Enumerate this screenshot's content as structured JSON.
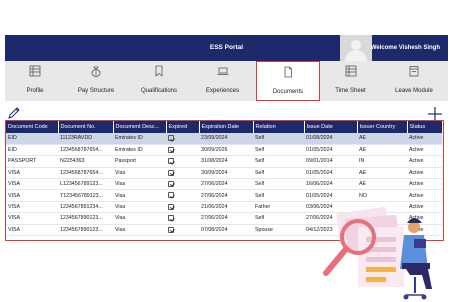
{
  "header": {
    "title": "ESS Portal",
    "welcome": "Welcome Vishesh Singh",
    "accent": "#1c2a6c"
  },
  "nav": {
    "tabs": [
      {
        "label": "Profile",
        "icon": "list-icon"
      },
      {
        "label": "Pay Structure",
        "icon": "money-bag-icon"
      },
      {
        "label": "Qualifications",
        "icon": "bookmark-icon"
      },
      {
        "label": "Experiences",
        "icon": "laptop-icon"
      },
      {
        "label": "Documents",
        "icon": "document-icon",
        "active": true
      },
      {
        "label": "Time Sheet",
        "icon": "list-icon"
      },
      {
        "label": "Leave Module",
        "icon": "calendar-icon"
      }
    ]
  },
  "actions": {
    "edit_icon": "pencil-icon",
    "add_icon": "plus-icon"
  },
  "table": {
    "columns": [
      "Document Code",
      "Document No.",
      "Document Desc...",
      "Expired",
      "Expiration Date",
      "Relation",
      "Issue Date",
      "Issuer Country",
      "Status"
    ],
    "rows": [
      {
        "code": "EID",
        "no": "11123RAVDD",
        "desc": "Emirates ID",
        "expired": true,
        "exp_date": "23/09/2024",
        "relation": "Self",
        "issue_date": "01/08/2024",
        "country": "AE",
        "status": "Active"
      },
      {
        "code": "EID",
        "no": "1234568787654...",
        "desc": "Emirates ID",
        "expired": true,
        "exp_date": "30/09/2026",
        "relation": "Self",
        "issue_date": "01/05/2024",
        "country": "AE",
        "status": "Active"
      },
      {
        "code": "PASSPORT",
        "no": "N2254363",
        "desc": "Passport",
        "expired": true,
        "exp_date": "31/08/2024",
        "relation": "Self",
        "issue_date": "09/01/2014",
        "country": "IN",
        "status": "Active"
      },
      {
        "code": "VISA",
        "no": "1234568787654...",
        "desc": "Visa",
        "expired": true,
        "exp_date": "30/09/2024",
        "relation": "Self",
        "issue_date": "01/05/2024",
        "country": "AE",
        "status": "Active"
      },
      {
        "code": "VISA",
        "no": "L123456789123...",
        "desc": "Visa",
        "expired": true,
        "exp_date": "27/06/2024",
        "relation": "Self",
        "issue_date": "16/06/2024",
        "country": "AE",
        "status": "Active"
      },
      {
        "code": "VISA",
        "no": "T123456789123...",
        "desc": "Visa",
        "expired": true,
        "exp_date": "27/06/2024",
        "relation": "Self",
        "issue_date": "01/05/2024",
        "country": "NO",
        "status": "Active"
      },
      {
        "code": "VISA",
        "no": "1234567891234...",
        "desc": "Visa",
        "expired": true,
        "exp_date": "21/06/2024",
        "relation": "Father",
        "issue_date": "03/06/2024",
        "country": "",
        "status": "Active"
      },
      {
        "code": "VISA",
        "no": "1234567890123...",
        "desc": "Visa",
        "expired": true,
        "exp_date": "27/06/2024",
        "relation": "Self",
        "issue_date": "27/06/2024",
        "country": "",
        "status": "Active"
      },
      {
        "code": "VISA",
        "no": "1234567890123...",
        "desc": "Visa",
        "expired": true,
        "exp_date": "07/08/2024",
        "relation": "Spouse",
        "issue_date": "04/12/2023",
        "country": "",
        "status": "Active"
      }
    ]
  }
}
